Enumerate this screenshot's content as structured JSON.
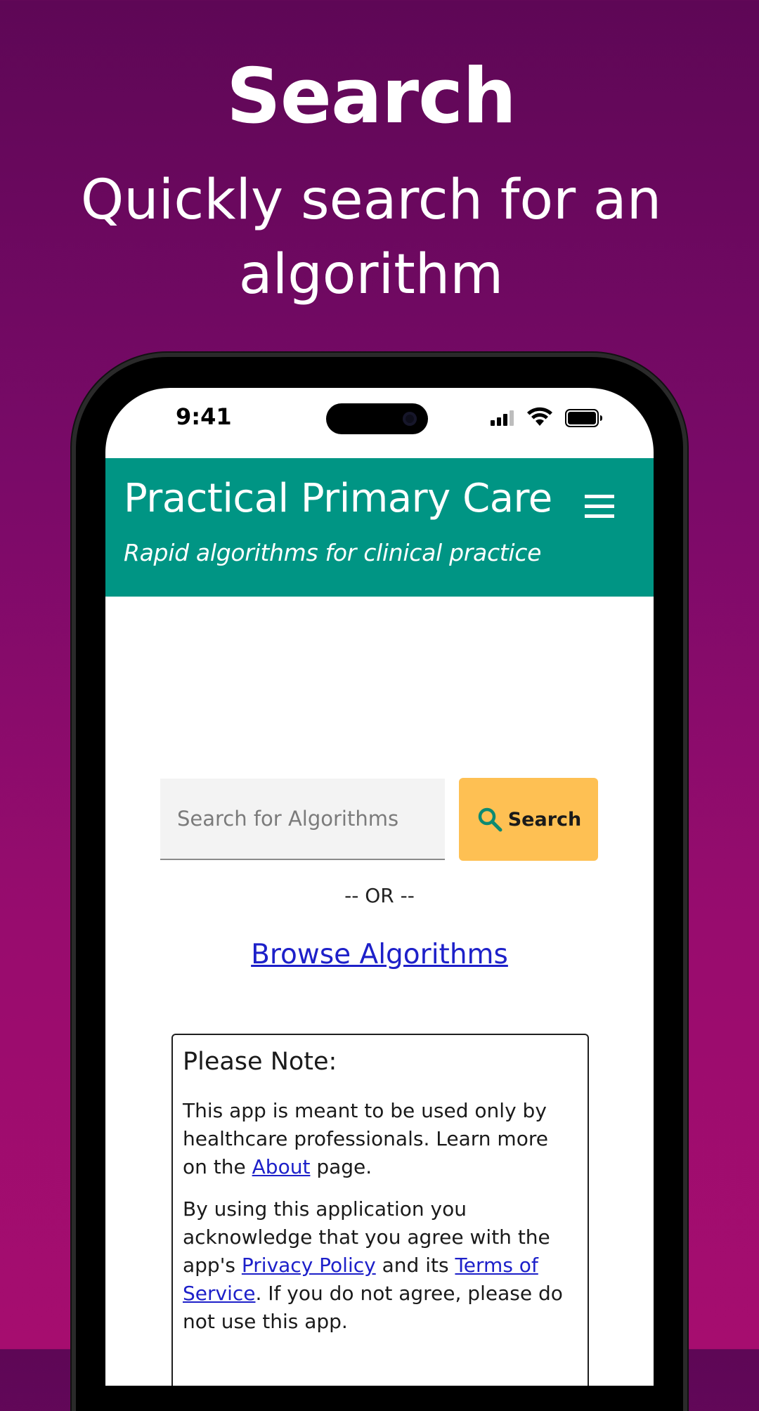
{
  "promo": {
    "title": "Search",
    "subtitle": "Quickly search for an algorithm"
  },
  "status_bar": {
    "time": "9:41",
    "icons": [
      "signal-icon",
      "wifi-icon",
      "battery-icon"
    ]
  },
  "header": {
    "title": "Practical Primary Care",
    "tagline": "Rapid algorithms for clinical practice",
    "menu_icon": "hamburger-menu-icon"
  },
  "search": {
    "placeholder": "Search for Algorithms",
    "value": "",
    "button_label": "Search",
    "button_icon": "magnifier-icon"
  },
  "divider": "-- OR --",
  "browse_link": "Browse Algorithms",
  "note": {
    "title": "Please Note:",
    "p1_text_a": "This app is meant to be used only by healthcare professionals. Learn more on the ",
    "p1_link": "About",
    "p1_text_b": " page.",
    "p2_text_a": "By using this application you acknowledge that you agree with the app's ",
    "p2_link_privacy": "Privacy Policy",
    "p2_text_b": " and its ",
    "p2_link_terms": "Terms of Service",
    "p2_text_c": ". If you do not agree, please do not use this app."
  },
  "colors": {
    "background_top": "#5e0756",
    "background_bottom": "#a60d6f",
    "header": "#009584",
    "search_button": "#fec053",
    "link": "#1d20c9"
  }
}
